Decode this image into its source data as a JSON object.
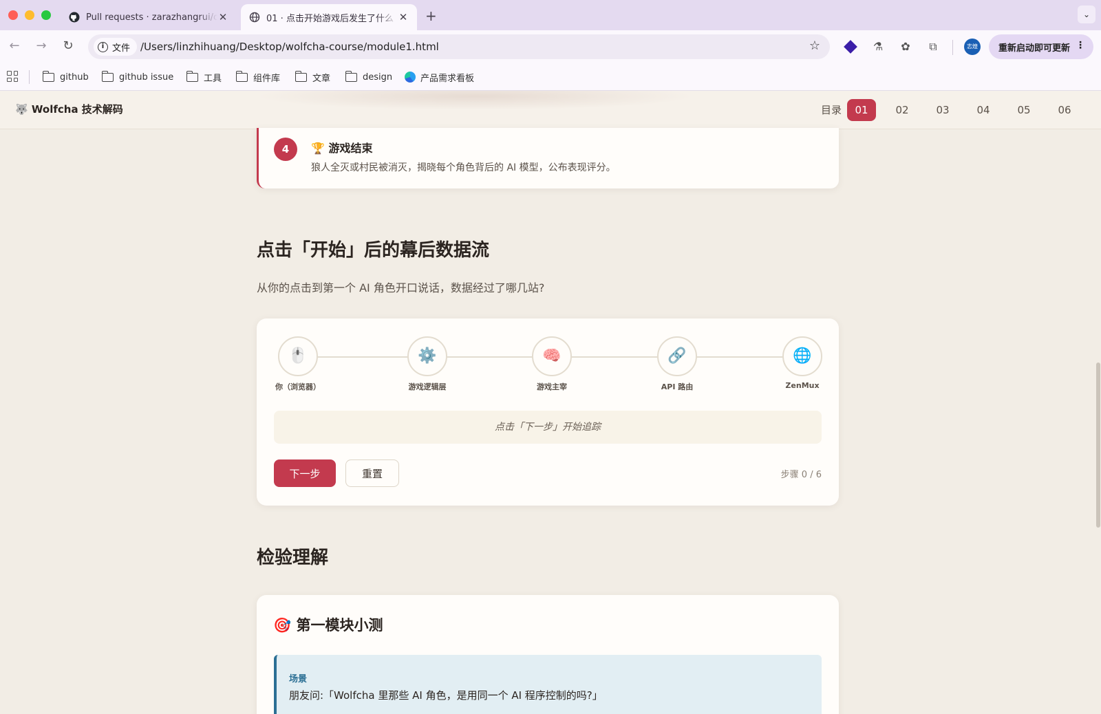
{
  "browser": {
    "tabs": [
      {
        "label": "Pull requests · zarazhangrui/claude-course",
        "active": false
      },
      {
        "label": "01 · 点击开始游戏后发生了什么",
        "active": true
      }
    ],
    "new_tab": "+",
    "close_glyph": "✕",
    "site_chip": "文件",
    "url": "/Users/linzhihuang/Desktop/wolfcha-course/module1.html",
    "avatar_text": "志煌",
    "update_label": "重新启动即可更新",
    "bookmarks": [
      {
        "label": "github",
        "icon": "folder-icon"
      },
      {
        "label": "github issue",
        "icon": "folder-icon"
      },
      {
        "label": "工具",
        "icon": "folder-icon"
      },
      {
        "label": "组件库",
        "icon": "folder-icon"
      },
      {
        "label": "文章",
        "icon": "folder-icon"
      },
      {
        "label": "design",
        "icon": "folder-icon"
      },
      {
        "label": "产品需求看板",
        "icon": "app-logo-icon"
      }
    ]
  },
  "site": {
    "brand": "🐺 Wolfcha 技术解码",
    "nav": {
      "toc": "目录",
      "modules": [
        "01",
        "02",
        "03",
        "04",
        "05",
        "06"
      ],
      "active": "01"
    }
  },
  "step4": {
    "number": "4",
    "title": "🏆 游戏结束",
    "desc": "狼人全灭或村民被消灭，揭晓每个角色背后的 AI 模型，公布表现评分。"
  },
  "dataflow": {
    "heading": "点击「开始」后的幕后数据流",
    "subtitle": "从你的点击到第一个 AI 角色开口说话，数据经过了哪几站?",
    "nodes": [
      {
        "icon": "🖱️",
        "label": "你（浏览器）"
      },
      {
        "icon": "⚙️",
        "label": "游戏逻辑层"
      },
      {
        "icon": "🧠",
        "label": "游戏主宰"
      },
      {
        "icon": "🔗",
        "label": "API 路由"
      },
      {
        "icon": "🌐",
        "label": "ZenMux"
      }
    ],
    "hint": "点击「下一步」开始追踪",
    "next_label": "下一步",
    "reset_label": "重置",
    "step_counter": "步骤 0 / 6",
    "current_step": 0,
    "total_steps": 6
  },
  "quiz": {
    "heading": "检验理解",
    "title": "🎯 第一模块小测",
    "scenario_label": "场景",
    "scenario_text": "朋友问:「Wolfcha 里那些 AI 角色，是用同一个 AI 程序控制的吗?」"
  },
  "colors": {
    "accent": "#c33a4e",
    "page_bg": "#f2ede5",
    "card_bg": "#fffdfa",
    "scenario_bg": "#e2eef3",
    "scenario_accent": "#2b6f94",
    "browser_chrome": "#e4daf0"
  }
}
